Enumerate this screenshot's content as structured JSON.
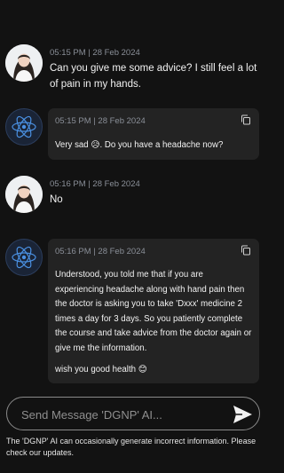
{
  "messages": [
    {
      "role": "user",
      "timestamp": "05:15 PM | 28 Feb 2024",
      "text": "Can you give me some advice? I still feel a lot of pain in my hands."
    },
    {
      "role": "bot",
      "timestamp": "05:15 PM | 28 Feb 2024",
      "text": "Very sad 😥. Do you have a headache now?"
    },
    {
      "role": "user",
      "timestamp": "05:16 PM | 28 Feb 2024",
      "text": "No"
    },
    {
      "role": "bot",
      "timestamp": "05:16 PM | 28 Feb 2024",
      "paragraphs": [
        "Understood, you told me that if you are experiencing headache along with hand pain then the doctor is asking you to take 'Dxxx' medicine 2 times a day for 3 days. So you patiently complete the course and take advice from the doctor again or give me the information.",
        "wish you good health 😊"
      ]
    }
  ],
  "composer": {
    "placeholder": "Send Message 'DGNP' AI..."
  },
  "disclaimer": "The 'DGNP' AI can occasionally generate incorrect information. Please check our updates.",
  "colors": {
    "background": "#121212",
    "bubble": "#232323",
    "timestamp": "#8a8f98",
    "bot_icon": "#4a90e2"
  },
  "icons": {
    "copy": "copy-icon",
    "send": "send-icon",
    "bot_avatar": "atom-icon"
  }
}
